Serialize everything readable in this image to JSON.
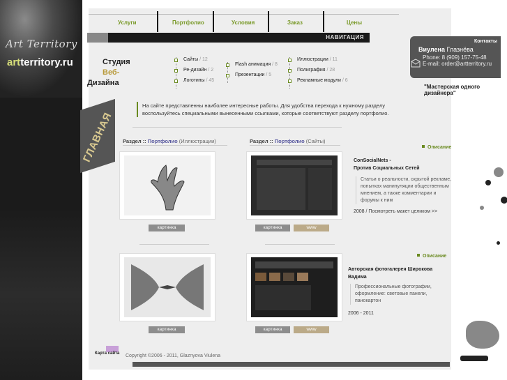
{
  "brand": {
    "script_name": "Art Territory",
    "site_prefix": "art",
    "site_rest": "territory.ru"
  },
  "topnav": {
    "items": [
      "Услуги",
      "Портфолио",
      "Условия",
      "Заказ",
      "Цены"
    ]
  },
  "navbar": {
    "label": "НАВИГАЦИЯ"
  },
  "studio": {
    "line1": "Студия",
    "line2": "Веб-",
    "line3": "Дизайна"
  },
  "categories": {
    "col1": [
      {
        "label": "Сайты",
        "count": " / 12"
      },
      {
        "label": "Ре-дизайн",
        "count": " / 2"
      },
      {
        "label": "Логотипы",
        "count": " / 45"
      }
    ],
    "col2": [
      {
        "label": "Flash анимация",
        "count": " / 8"
      },
      {
        "label": "Презентации",
        "count": " / 5"
      }
    ],
    "col3": [
      {
        "label": "Иллюстрации",
        "count": " / 11"
      },
      {
        "label": "Полиграфия",
        "count": " / 28"
      },
      {
        "label": "Рекламные модули",
        "count": " / 6"
      }
    ]
  },
  "contact": {
    "tab": "Контакты",
    "first_name": "Виулена",
    "last_name": "Глазнёва",
    "phone": "Phone: 8 (909) 157-75-48",
    "email": "E-mail: order@artterritory.ru",
    "master": "\"Мастерская одного дизайнера\""
  },
  "glavnaya": "ГЛАВНАЯ",
  "intro": "На сайте представленны наиболее интересные работы. Для удобства перехода к нужному разделу воспользуйтесь специальными вынесенными ссылками, которые соответствуют разделу портфолио.",
  "sections": {
    "left_head": {
      "prefix": "Раздел :: ",
      "accent": "Портфолио",
      "sub": " (Иллюстрации)"
    },
    "right_head": {
      "prefix": "Раздел :: ",
      "accent": "Портфолио",
      "sub": " (Сайты)"
    }
  },
  "buttons": {
    "picture": "картинка",
    "www": "www"
  },
  "projects": [
    {
      "desc_label": "Описание",
      "title": "ConSocialNets -\nПротив Социальных Сетей",
      "text": "Статьи о реальности, скрытой рекламе, попытках манипуляции общественным мнением, а также комментарии и форумы к ним",
      "year": "2008",
      "link": " / Посмотреть макет целиком >>"
    },
    {
      "desc_label": "Описание",
      "title": "Авторская фотогалерея Широкова Вадима",
      "text": "Профессиональные фотографии, оформление: световые панели, панокартон",
      "year": "2006 - 2011"
    }
  ],
  "footer": {
    "sitemap": "Карта сайта",
    "copyright": "Copyright ©2006 - 2011, Glaznyova Viulena"
  },
  "colors": {
    "accent_green": "#6a8a20",
    "accent_gold": "#b89a3a",
    "dark": "#1a1a1a"
  }
}
